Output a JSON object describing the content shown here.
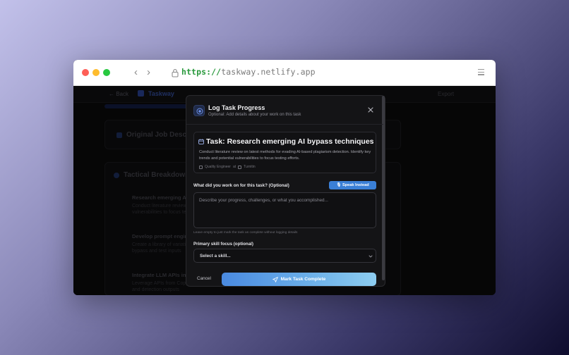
{
  "browser": {
    "url_protocol": "https://",
    "url_host": "taskway.netlify.app"
  },
  "background_app": {
    "back_label": "← Back",
    "brand": "Taskway",
    "export_label": "Export",
    "card1_title": "Original Job Descri",
    "card2_title": "Tactical Breakdown",
    "items": [
      {
        "title": "Research emerging AI",
        "line1": "Conduct literature review on",
        "line2": "vulnerabilities to focus testing"
      },
      {
        "title": "Develop prompt engine",
        "line1": "Create a library of variations",
        "line2": "bypass and test inputs"
      },
      {
        "title": "Integrate LLM APIs into",
        "line1": "Leverage APIs from Copy.ai/Ope",
        "line2": "and detection outputs"
      }
    ]
  },
  "modal": {
    "title": "Log Task Progress",
    "subtitle": "Optional: Add details about your work on this task",
    "task_title": "Task: Research emerging AI bypass techniques",
    "task_description": "Conduct literature review on latest methods for evading AI-based plagiarism detection. Identify key trends and potential vulnerabilities to focus testing efforts.",
    "meta_role": "Quality Engineer",
    "meta_separator": "at",
    "meta_company": "Turnitin",
    "work_label": "What did you work on for this task? (Optional)",
    "speak_label": "🎙 Speak Instead",
    "textarea_placeholder": "Describe your progress, challenges, or what you accomplished...",
    "helper_text": "Leave empty to just mark the task as complete without logging details",
    "skill_label": "Primary skill focus (optional)",
    "skill_selected": "Select a skill...",
    "cancel_label": "Cancel",
    "complete_label": "Mark Task Complete"
  },
  "colors": {
    "accent": "#3a7fd6",
    "gradient_start": "#4a8ae0",
    "gradient_end": "#8dcdf0"
  }
}
